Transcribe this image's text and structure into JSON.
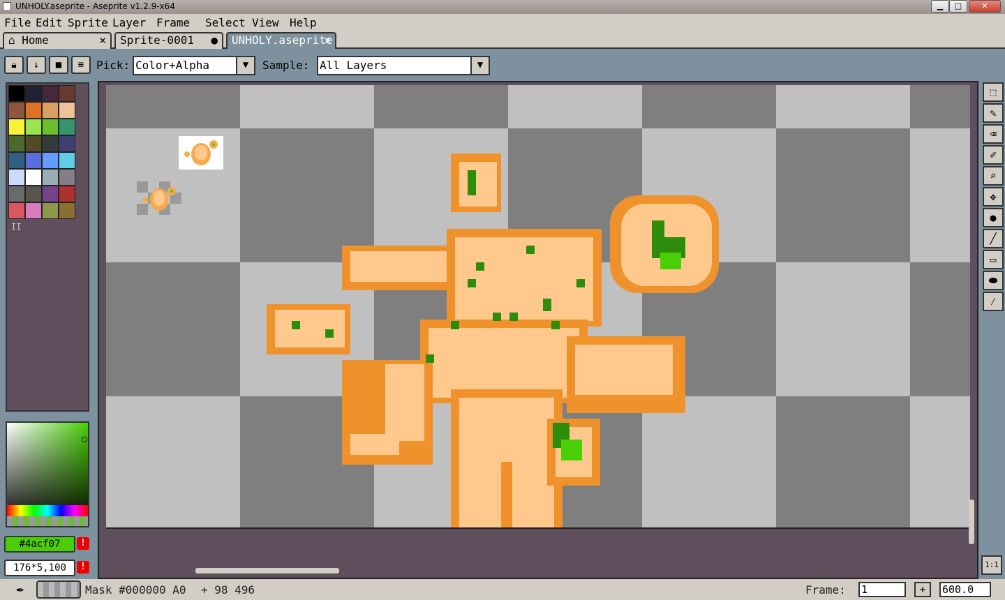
{
  "window": {
    "title": "UNHOLY.aseprite - Aseprite v1.2.9-x64",
    "minimize": "▁",
    "maximize": "□",
    "close": "✕"
  },
  "menu": [
    "File",
    "Edit",
    "Sprite",
    "Layer",
    "Frame",
    "Select",
    "View",
    "Help"
  ],
  "tabs": [
    {
      "label": "Home",
      "close": "×"
    },
    {
      "label": "Sprite-0001",
      "close": "●"
    },
    {
      "label": "UNHOLY.aseprite",
      "close": "×"
    }
  ],
  "toolbar": {
    "pick_label": "Pick:",
    "pick_value": "Color+Alpha",
    "sample_label": "Sample:",
    "sample_value": "All Layers",
    "arrow": "▼"
  },
  "palette": {
    "colors": [
      "#000000",
      "#222034",
      "#45283c",
      "#663931",
      "#8f563b",
      "#df7126",
      "#d9a066",
      "#eec39a",
      "#fbf236",
      "#99e550",
      "#6abe30",
      "#37946e",
      "#4b692f",
      "#524b24",
      "#323c39",
      "#3f3f74",
      "#306082",
      "#5b6ee1",
      "#639bff",
      "#5fcde4",
      "#cbdbfc",
      "#ffffff",
      "#9badb7",
      "#847e87",
      "#696a6a",
      "#595652",
      "#76428a",
      "#ac3232",
      "#d95763",
      "#d77bba",
      "#8f974a",
      "#8a6f30"
    ],
    "mode_marker": "II"
  },
  "color_bar": {
    "fg_hex": "#4acf07",
    "warning": "!",
    "size": "176*5,100"
  },
  "status": {
    "mask": "Mask #000000 A0",
    "coords": "+ 98 496",
    "frame_label": "Frame:",
    "frame_value": "1",
    "add": "+",
    "zoom": "600.0"
  },
  "tools": [
    "marquee",
    "pencil",
    "eraser",
    "eyedropper",
    "zoom",
    "move",
    "paint-bucket",
    "line",
    "rectangle",
    "blur-ink",
    "spray"
  ],
  "onebyone": "1:1",
  "colors": {
    "skin": "#ffc98d",
    "skin_shade": "#f8a94b",
    "outline": "#f0922b",
    "eye": "#2e8c0c",
    "eye_bright": "#4acf07"
  }
}
